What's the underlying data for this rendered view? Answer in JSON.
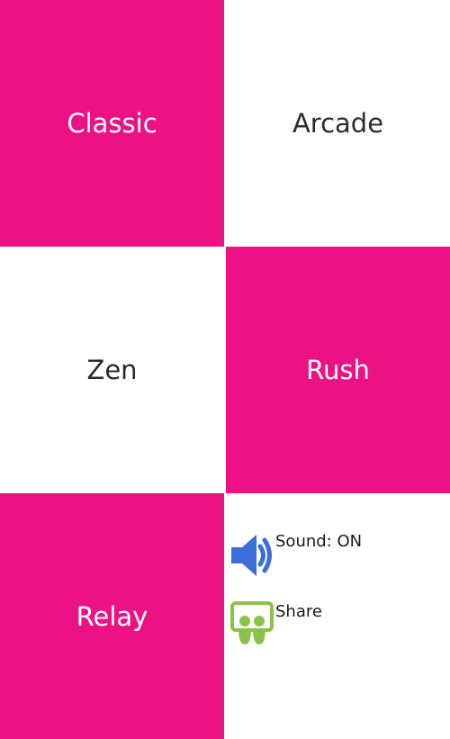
{
  "modes": [
    {
      "label": "Classic",
      "style": "pink"
    },
    {
      "label": "Arcade",
      "style": "white"
    },
    {
      "label": "Zen",
      "style": "white"
    },
    {
      "label": "Rush",
      "style": "pink"
    },
    {
      "label": "Relay",
      "style": "pink"
    }
  ],
  "options": {
    "sound": {
      "label": "Sound: ON",
      "icon": "speaker-icon"
    },
    "share": {
      "label": "Share",
      "icon": "share-icon"
    }
  },
  "colors": {
    "pink": "#ec1184",
    "white": "#ffffff",
    "speaker_blue": "#3d6fd8",
    "share_green": "#8bc34a"
  }
}
